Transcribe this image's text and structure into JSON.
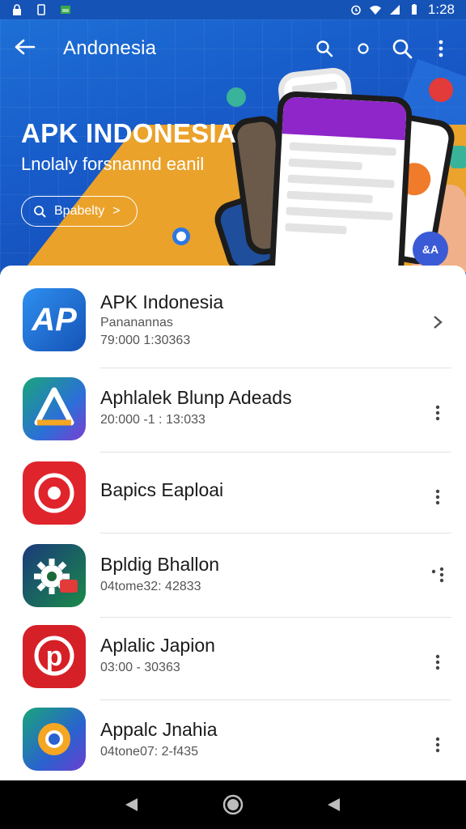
{
  "status_bar": {
    "time": "1:28",
    "icons": [
      "lock-icon",
      "sim-icon",
      "image-icon",
      "alarm-icon",
      "wifi-icon",
      "signal-icon",
      "battery-icon"
    ]
  },
  "app_bar": {
    "title": "Andonesia",
    "actions": [
      "search-icon",
      "record-icon",
      "search-icon",
      "more-vert-icon"
    ]
  },
  "hero": {
    "title": "APK INDONESIA",
    "subtitle": "Lnolaly forsnannd eanil",
    "button_label": "Bpabelty",
    "button_arrow": ">"
  },
  "fab": {
    "label": "&A"
  },
  "apps": [
    {
      "name": "APK Indonesia",
      "sub": "Pananannas",
      "sub2": "79:000 1:30363",
      "icon": "ap-logo-icon",
      "icon_text": "AP",
      "color": "#1f6fd4"
    },
    {
      "name": "Aphlalek Blunp Adeads",
      "sub": "20:000 -1 : 13:033",
      "icon": "drive-triangle-icon",
      "color": "#1ea46a"
    },
    {
      "name": "Bapics Eaploai",
      "sub": "",
      "icon": "camera-ring-icon",
      "color": "#e0242c"
    },
    {
      "name": "Bpldig Bhallon",
      "sub": "04tome32: 42833",
      "icon": "gear-icon",
      "color": "#1a3a7a"
    },
    {
      "name": "Aplalic Japion",
      "sub": "03:00 - 30363",
      "icon": "pinterest-icon",
      "color": "#d62027"
    },
    {
      "name": "Appalc Jnahia",
      "sub": "04tone07: 2-f435",
      "icon": "chrome-icon",
      "color": "#2a62cf"
    }
  ],
  "nav": [
    "back-icon",
    "home-icon",
    "recents-icon"
  ]
}
